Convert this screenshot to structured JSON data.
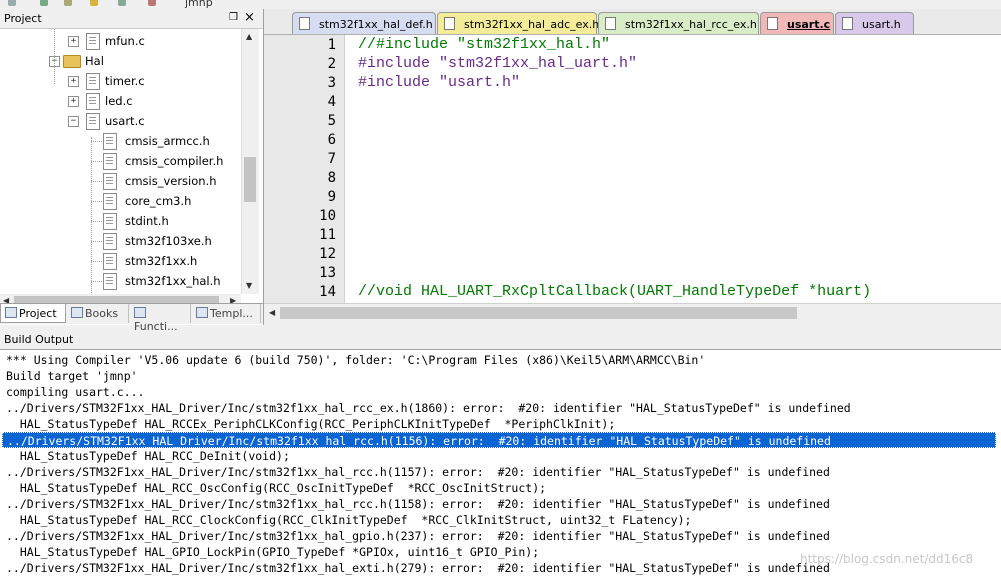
{
  "toolbar": {
    "partial_text": "jmnp"
  },
  "project_panel": {
    "title": "Project",
    "pin_glyph": "❒",
    "close_glyph": "×",
    "tree": [
      {
        "label": "mfun.c",
        "type": "file",
        "expander": "+"
      },
      {
        "label": "Hal",
        "type": "folder",
        "expander": "−"
      },
      {
        "label": "timer.c",
        "type": "file",
        "expander": "+"
      },
      {
        "label": "led.c",
        "type": "file",
        "expander": "+"
      },
      {
        "label": "usart.c",
        "type": "file",
        "expander": "−"
      },
      {
        "label": "cmsis_armcc.h",
        "type": "file"
      },
      {
        "label": "cmsis_compiler.h",
        "type": "file"
      },
      {
        "label": "cmsis_version.h",
        "type": "file"
      },
      {
        "label": "core_cm3.h",
        "type": "file"
      },
      {
        "label": "stdint.h",
        "type": "file"
      },
      {
        "label": "stm32f103xe.h",
        "type": "file"
      },
      {
        "label": "stm32f1xx.h",
        "type": "file"
      },
      {
        "label": "stm32f1xx_hal.h",
        "type": "file"
      }
    ],
    "tabs": [
      {
        "label": "Project",
        "active": true
      },
      {
        "label": "Books",
        "active": false
      },
      {
        "label": "Functi...",
        "active": false
      },
      {
        "label": "Templ...",
        "active": false
      }
    ]
  },
  "editor": {
    "tabs": [
      {
        "label": "stm32f1xx_hal_def.h",
        "color": "#d6dcf2",
        "active": false
      },
      {
        "label": "stm32f1xx_hal_adc_ex.h",
        "color": "#f5ec9a",
        "active": false
      },
      {
        "label": "stm32f1xx_hal_rcc_ex.h",
        "color": "#d8ecc8",
        "active": false
      },
      {
        "label": "usart.c",
        "color": "#f2b8b8",
        "active": true
      },
      {
        "label": "usart.h",
        "color": "#d8c8ea",
        "active": false
      }
    ],
    "lines": [
      {
        "n": "1",
        "parts": [
          {
            "t": "//#include \"stm32f1xx_hal.h\"",
            "c": "c-comment"
          }
        ]
      },
      {
        "n": "2",
        "parts": [
          {
            "t": "#include ",
            "c": "c-pp"
          },
          {
            "t": "\"stm32f1xx_hal_uart.h\"",
            "c": "c-str"
          }
        ]
      },
      {
        "n": "3",
        "parts": [
          {
            "t": "#include ",
            "c": "c-pp"
          },
          {
            "t": "\"usart.h\"",
            "c": "c-str"
          }
        ]
      },
      {
        "n": "4",
        "parts": []
      },
      {
        "n": "5",
        "parts": []
      },
      {
        "n": "6",
        "parts": []
      },
      {
        "n": "7",
        "parts": []
      },
      {
        "n": "8",
        "parts": []
      },
      {
        "n": "9",
        "parts": []
      },
      {
        "n": "10",
        "parts": []
      },
      {
        "n": "11",
        "parts": []
      },
      {
        "n": "12",
        "parts": []
      },
      {
        "n": "13",
        "parts": []
      },
      {
        "n": "14",
        "parts": [
          {
            "t": "//void HAL_UART_RxCpltCallback(UART_HandleTypeDef *huart)",
            "c": "c-comment"
          }
        ]
      }
    ]
  },
  "build_output": {
    "title": "Build Output",
    "lines": [
      {
        "text": "*** Using Compiler 'V5.06 update 6 (build 750)', folder: 'C:\\Program Files (x86)\\Keil5\\ARM\\ARMCC\\Bin'",
        "selected": false
      },
      {
        "text": "Build target 'jmnp'",
        "selected": false
      },
      {
        "text": "compiling usart.c...",
        "selected": false
      },
      {
        "text": "../Drivers/STM32F1xx_HAL_Driver/Inc/stm32f1xx_hal_rcc_ex.h(1860): error:  #20: identifier \"HAL_StatusTypeDef\" is undefined",
        "selected": false
      },
      {
        "text": "  HAL_StatusTypeDef HAL_RCCEx_PeriphCLKConfig(RCC_PeriphCLKInitTypeDef  *PeriphClkInit);",
        "selected": false
      },
      {
        "text": "../Drivers/STM32F1xx_HAL_Driver/Inc/stm32f1xx_hal_rcc.h(1156): error:  #20: identifier \"HAL_StatusTypeDef\" is undefined",
        "selected": true
      },
      {
        "text": "  HAL_StatusTypeDef HAL_RCC_DeInit(void);",
        "selected": false
      },
      {
        "text": "../Drivers/STM32F1xx_HAL_Driver/Inc/stm32f1xx_hal_rcc.h(1157): error:  #20: identifier \"HAL_StatusTypeDef\" is undefined",
        "selected": false
      },
      {
        "text": "  HAL_StatusTypeDef HAL_RCC_OscConfig(RCC_OscInitTypeDef  *RCC_OscInitStruct);",
        "selected": false
      },
      {
        "text": "../Drivers/STM32F1xx_HAL_Driver/Inc/stm32f1xx_hal_rcc.h(1158): error:  #20: identifier \"HAL_StatusTypeDef\" is undefined",
        "selected": false
      },
      {
        "text": "  HAL_StatusTypeDef HAL_RCC_ClockConfig(RCC_ClkInitTypeDef  *RCC_ClkInitStruct, uint32_t FLatency);",
        "selected": false
      },
      {
        "text": "../Drivers/STM32F1xx_HAL_Driver/Inc/stm32f1xx_hal_gpio.h(237): error:  #20: identifier \"HAL_StatusTypeDef\" is undefined",
        "selected": false
      },
      {
        "text": "  HAL_StatusTypeDef HAL_GPIO_LockPin(GPIO_TypeDef *GPIOx, uint16_t GPIO_Pin);",
        "selected": false
      },
      {
        "text": "../Drivers/STM32F1xx_HAL_Driver/Inc/stm32f1xx_hal_exti.h(279): error:  #20: identifier \"HAL_StatusTypeDef\" is undefined",
        "selected": false
      }
    ],
    "watermark": "https://blog.csdn.net/dd16c8"
  },
  "colors": {
    "selection": "#0a64d2",
    "comment": "#007a00",
    "preprocessor": "#6a2a8a"
  }
}
